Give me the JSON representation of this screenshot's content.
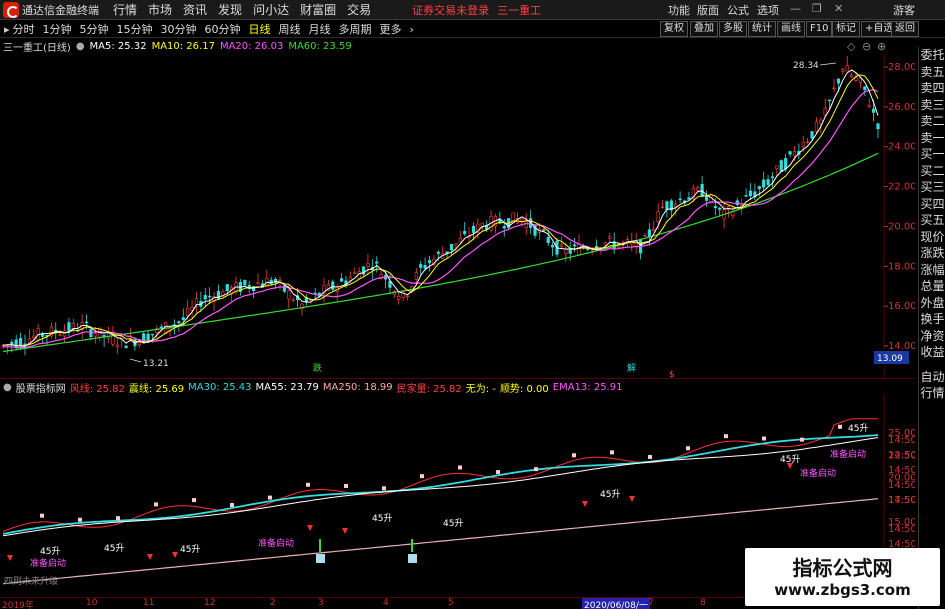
{
  "window": {
    "app_title": "通达信金融终端",
    "menu": [
      "行情",
      "市场",
      "资讯",
      "发现",
      "问小达",
      "财富圈",
      "交易"
    ],
    "login_msg": "证券交易未登录",
    "stock_name": "三一重工",
    "right_menu": [
      "功能",
      "版面",
      "公式",
      "选项",
      "游客"
    ]
  },
  "toolbar": {
    "periods": [
      "分时",
      "1分钟",
      "5分钟",
      "15分钟",
      "30分钟",
      "60分钟",
      "日线",
      "周线",
      "月线",
      "多周期",
      "更多"
    ],
    "active_period": "日线",
    "right_buttons": [
      "复权",
      "叠加",
      "多股",
      "统计",
      "画线",
      "F10",
      "标记",
      "+自选",
      "返回"
    ]
  },
  "main_header": {
    "stock": "三一重工(日线)",
    "ma": [
      {
        "label": "MA5: 25.32",
        "color": "#ffffff"
      },
      {
        "label": "MA10: 26.17",
        "color": "#ffff00"
      },
      {
        "label": "MA20: 26.03",
        "color": "#ff55ff"
      },
      {
        "label": "MA60: 23.59",
        "color": "#33dd33"
      }
    ]
  },
  "main_chart": {
    "y_ticks": [
      "28.00",
      "26.00",
      "24.00",
      "22.00",
      "20.00",
      "18.00",
      "16.00",
      "14.00"
    ],
    "high_label": "28.34",
    "low_label": "13.21",
    "current_price": "13.09",
    "signal_labels": [
      "跌",
      "解",
      "$"
    ]
  },
  "lower_header": {
    "title": "股票指标网",
    "items": [
      {
        "label": "风线: 25.82",
        "color": "#ff4040"
      },
      {
        "label": "震线: 25.69",
        "color": "#ffff00"
      },
      {
        "label": "MA30: 25.43",
        "color": "#33dddd"
      },
      {
        "label": "MA55: 23.79",
        "color": "#ffffff"
      },
      {
        "label": "MA250: 18.99",
        "color": "#ffaaaa"
      },
      {
        "label": "民家量: 25.82",
        "color": "#ff4040"
      },
      {
        "label": "无为: -",
        "color": "#ffff00"
      },
      {
        "label": "顺势: 0.00",
        "color": "#ffff00"
      },
      {
        "label": "EMA13: 25.91",
        "color": "#ff55ff"
      }
    ]
  },
  "lower_chart": {
    "y_ticks": [
      "25.00",
      "22.50",
      "20.00",
      "17.50",
      "15.00"
    ],
    "right_ticks": [
      "14:50",
      "14:50",
      "14:50",
      "14:50",
      "14:50",
      "14:50",
      "14:50",
      "14:50",
      "14:50"
    ],
    "annotations": [
      "45升",
      "45升",
      "45升",
      "45升",
      "45升",
      "45升",
      "45升",
      "45升",
      "45升"
    ],
    "start_label": "准备启动",
    "bottom_label": "四则未来升级"
  },
  "sidebar": [
    "委托",
    "卖五",
    "卖四",
    "卖三",
    "卖二",
    "卖一",
    "买一",
    "买二",
    "买三",
    "买四",
    "买五",
    "现价",
    "涨跌",
    "涨幅",
    "总量",
    "外盘",
    "换手",
    "净资",
    "收益",
    "自动",
    "行情"
  ],
  "date_axis": {
    "labels": [
      "2019年",
      "10",
      "11",
      "12",
      "2",
      "3",
      "4",
      "5",
      "7",
      "8"
    ],
    "cursor": "2020/06/08/一"
  },
  "watermark": {
    "title": "指标公式网",
    "url": "www.zbgs3.com"
  },
  "colors": {
    "bg": "#000000",
    "axis": "#cc3333",
    "up": "#ff4040",
    "ma5": "#ffffff",
    "ma10": "#ffff00",
    "ma20": "#ff55ff",
    "ma60": "#33dd33"
  }
}
